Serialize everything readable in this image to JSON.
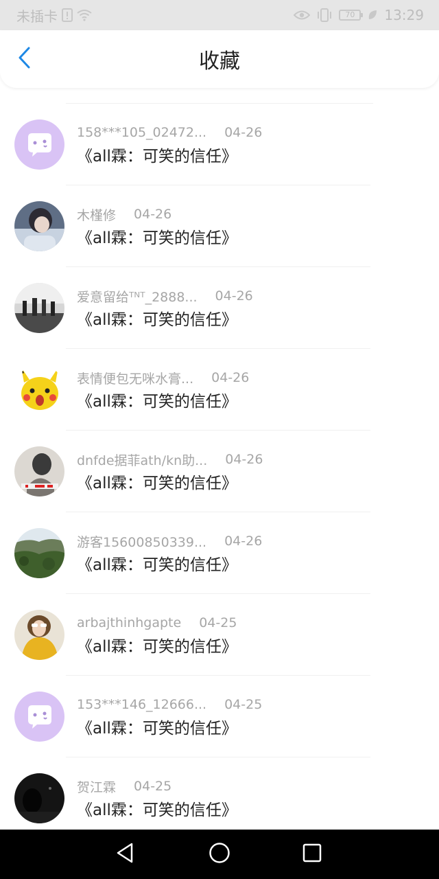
{
  "status_bar": {
    "carrier": "未插卡",
    "battery": "70",
    "time": "13:29"
  },
  "header": {
    "title": "收藏"
  },
  "items": [
    {
      "username": "158***105_02472...",
      "date": "04-26",
      "title": "《all霖：可笑的信任》",
      "avatar": "mascot-avatar"
    },
    {
      "username": "木槿修",
      "date": "04-26",
      "title": "《all霖：可笑的信任》",
      "avatar": "photo-avatar"
    },
    {
      "username": "爱意留给ᵀᴺᵀ_2888...",
      "date": "04-26",
      "title": "《all霖：可笑的信任》",
      "avatar": "photo-avatar"
    },
    {
      "username": "表情便包无咪水膏...",
      "date": "04-26",
      "title": "《all霖：可笑的信任》",
      "avatar": "pikachu-avatar"
    },
    {
      "username": "dnfde据菲ath/kn助...",
      "date": "04-26",
      "title": "《all霖：可笑的信任》",
      "avatar": "photo-avatar"
    },
    {
      "username": "游客15600850339...",
      "date": "04-26",
      "title": "《all霖：可笑的信任》",
      "avatar": "landscape-avatar"
    },
    {
      "username": "arbajthinhgapte",
      "date": "04-25",
      "title": "《all霖：可笑的信任》",
      "avatar": "photo-avatar"
    },
    {
      "username": "153***146_12666...",
      "date": "04-25",
      "title": "《all霖：可笑的信任》",
      "avatar": "mascot-avatar"
    },
    {
      "username": "贺江霖",
      "date": "04-25",
      "title": "《all霖：可笑的信任》",
      "avatar": "dark-photo-avatar"
    }
  ],
  "colors": {
    "accent": "#1e88e5",
    "mascot_bg": "#d9c3f5",
    "meta_text": "#a6a6a6",
    "title_text": "#222222"
  },
  "nav": {
    "icons": [
      "back-triangle-icon",
      "home-circle-icon",
      "recents-square-icon"
    ]
  }
}
